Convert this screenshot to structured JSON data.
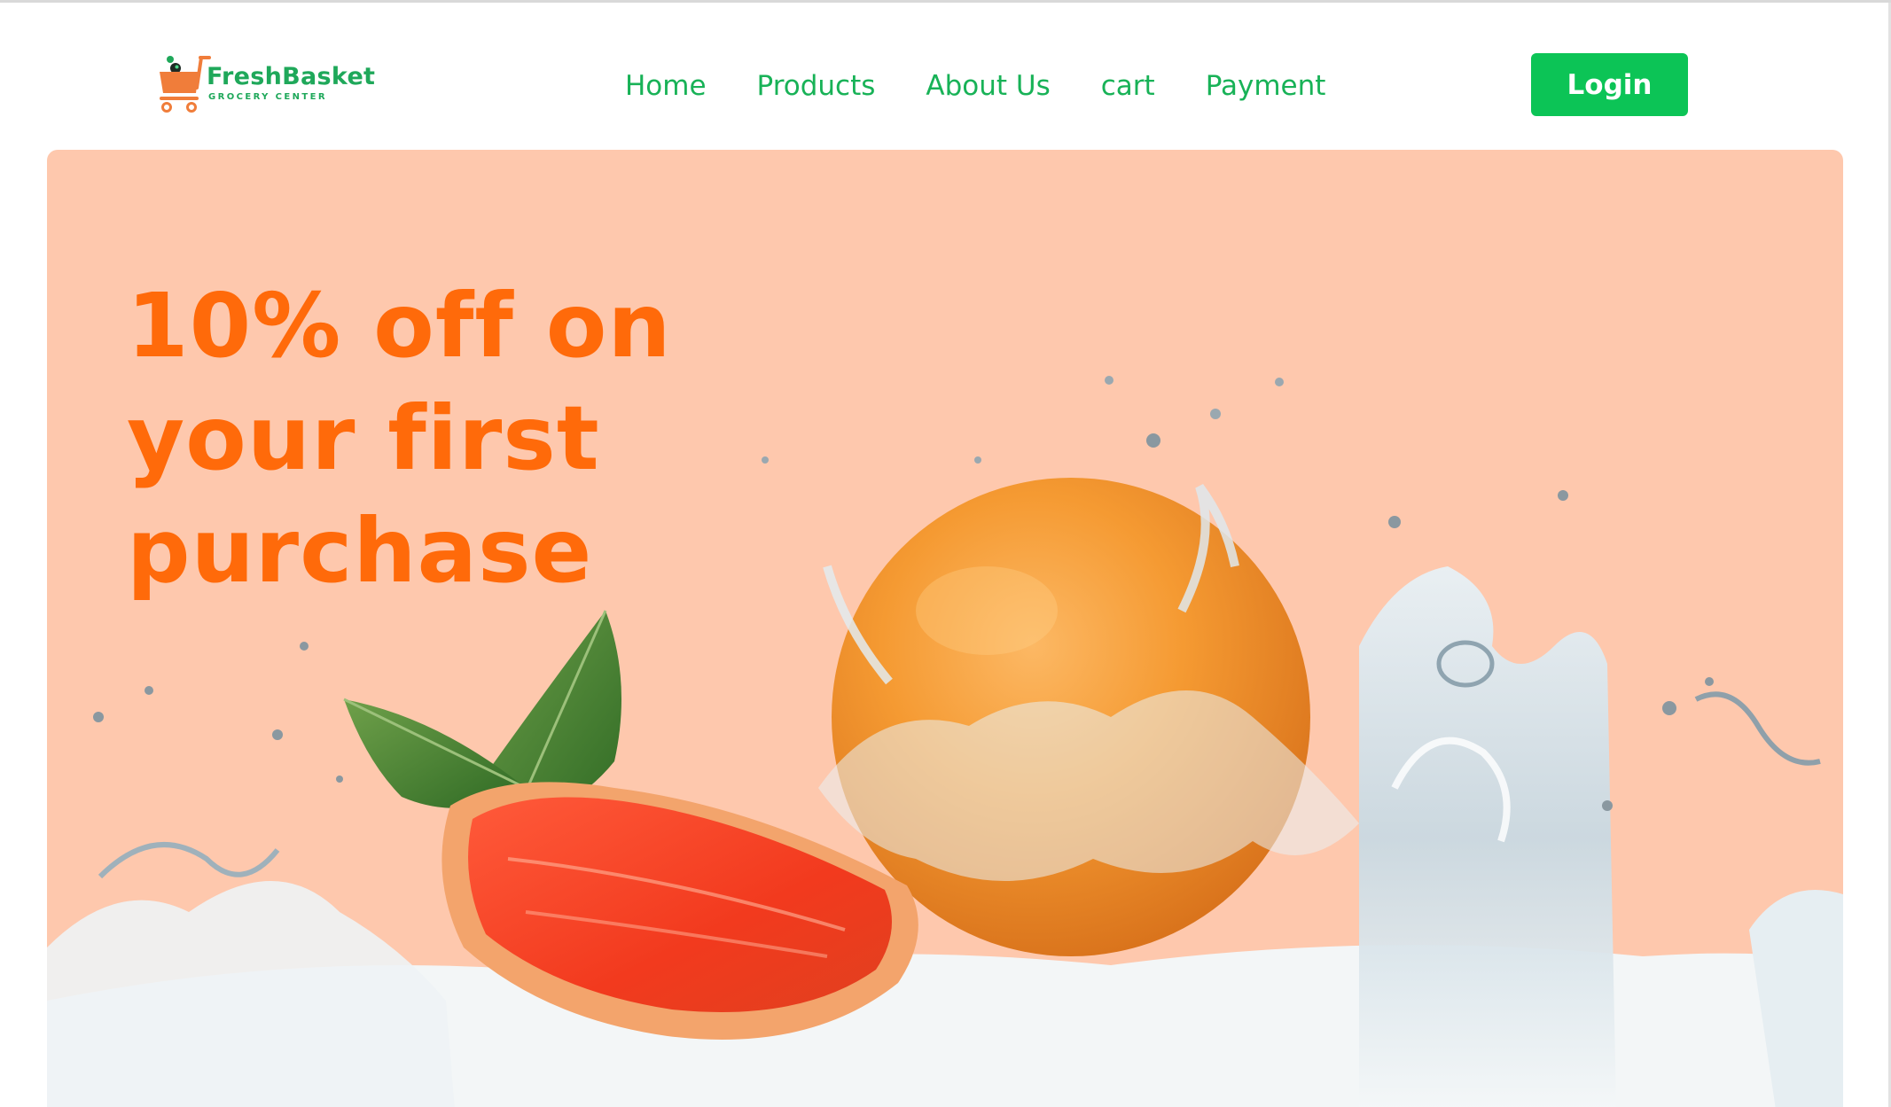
{
  "logo": {
    "title": "FreshBasket",
    "subtitle": "GROCERY CENTER",
    "icon": "shopping-cart-icon",
    "brand_color": "#1fa85a",
    "cart_color": "#f07d3a"
  },
  "nav": {
    "items": [
      {
        "label": "Home"
      },
      {
        "label": "Products"
      },
      {
        "label": "About Us"
      },
      {
        "label": "cart"
      },
      {
        "label": "Payment"
      }
    ],
    "color": "#18b257"
  },
  "login": {
    "label": "Login",
    "color": "#0cc456"
  },
  "hero": {
    "headline": "10% off on your first purchase",
    "headline_color": "#ff6a0a",
    "background": "#fec8ad",
    "image": "grapefruit-water-splash"
  }
}
